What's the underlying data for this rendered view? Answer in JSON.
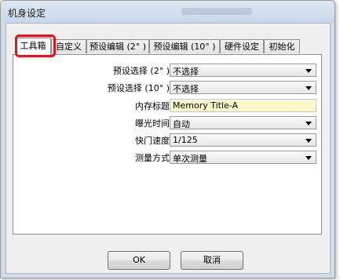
{
  "window": {
    "title": "机身设定"
  },
  "tabs": [
    {
      "label": "工具箱"
    },
    {
      "label": "自定义"
    },
    {
      "label": "预设编辑 (2° )"
    },
    {
      "label": "预设编辑 (10° )"
    },
    {
      "label": "硬件设定"
    },
    {
      "label": "初始化"
    }
  ],
  "form": {
    "rows": [
      {
        "label": "预设选择 (2° )",
        "value": "不选择",
        "type": "combo"
      },
      {
        "label": "预设选择 (10° )",
        "value": "不选择",
        "type": "combo"
      },
      {
        "label": "内存标题",
        "value": "Memory Title-A",
        "type": "text"
      },
      {
        "label": "曝光时间",
        "value": "自动",
        "type": "combo"
      },
      {
        "label": "快门速度",
        "value": "1/125",
        "type": "combo"
      },
      {
        "label": "测量方式",
        "value": "单次测量",
        "type": "combo"
      }
    ]
  },
  "buttons": {
    "ok": "OK",
    "cancel": "取消"
  },
  "colors": {
    "highlight": "#e3141d",
    "text_field_bg": "#fbf8c9",
    "window_frame": "#cfdcea"
  }
}
